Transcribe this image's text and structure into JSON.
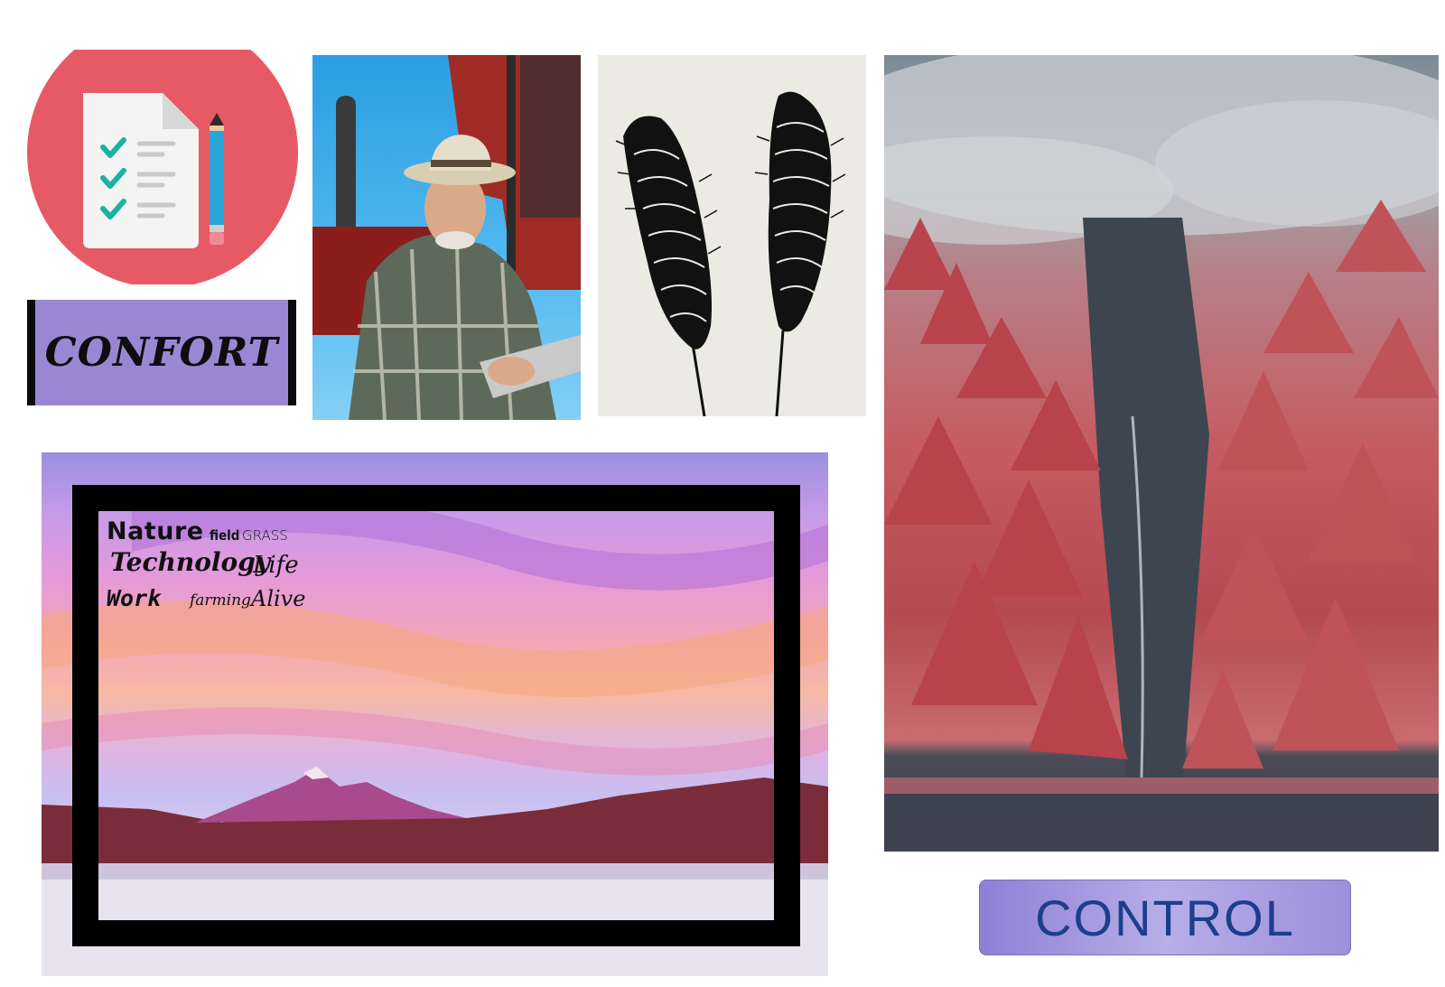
{
  "confort": {
    "label": "CONFORT"
  },
  "word_cloud": {
    "nature": "Nature",
    "field": "field",
    "grass": "grass",
    "technology": "Technology",
    "life": "Life",
    "work": "Work",
    "farming": "farming",
    "alive": "Alive"
  },
  "control": {
    "label": "CONTROL"
  },
  "colors": {
    "checklist_disc": "#e65a66",
    "confort_bg": "#9a87d4",
    "control_text": "#1c3f8a",
    "forest_red": "#c65a61"
  },
  "icons": [
    "checklist-icon",
    "pencil-icon",
    "wheat-icon"
  ]
}
